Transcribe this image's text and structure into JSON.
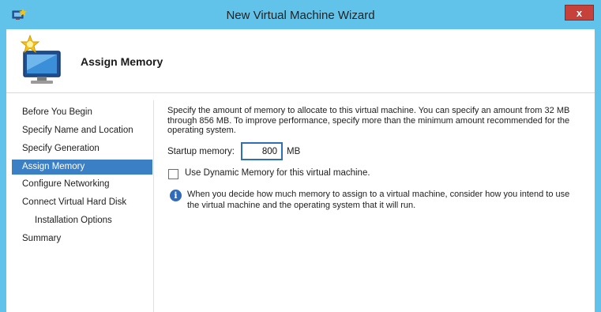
{
  "window": {
    "title": "New Virtual Machine Wizard",
    "close_glyph": "x"
  },
  "header": {
    "title": "Assign Memory"
  },
  "nav": {
    "items": [
      {
        "label": "Before You Begin"
      },
      {
        "label": "Specify Name and Location"
      },
      {
        "label": "Specify Generation"
      },
      {
        "label": "Assign Memory",
        "selected": true
      },
      {
        "label": "Configure Networking"
      },
      {
        "label": "Connect Virtual Hard Disk"
      },
      {
        "label": "Installation Options"
      },
      {
        "label": "Summary"
      }
    ]
  },
  "content": {
    "description": "Specify the amount of memory to allocate to this virtual machine. You can specify an amount from 32 MB through 856 MB. To improve performance, specify more than the minimum amount recommended for the operating system.",
    "startup_memory_label": "Startup memory:",
    "startup_memory_value": "800",
    "startup_memory_unit": "MB",
    "dynamic_memory_label": "Use Dynamic Memory for this virtual machine.",
    "dynamic_memory_checked": false,
    "info_text": "When you decide how much memory to assign to a virtual machine, consider how you intend to use the virtual machine and the operating system that it will run."
  },
  "icons": {
    "app": "hyperv-app-icon",
    "header": "new-vm-wizard-icon",
    "info": "info-icon"
  },
  "colors": {
    "title_bar": "#62c3ea",
    "close_button": "#c7413b",
    "selected_nav": "#3b7fc4",
    "input_border": "#2f6fb3",
    "info_icon": "#2f6bb8"
  }
}
